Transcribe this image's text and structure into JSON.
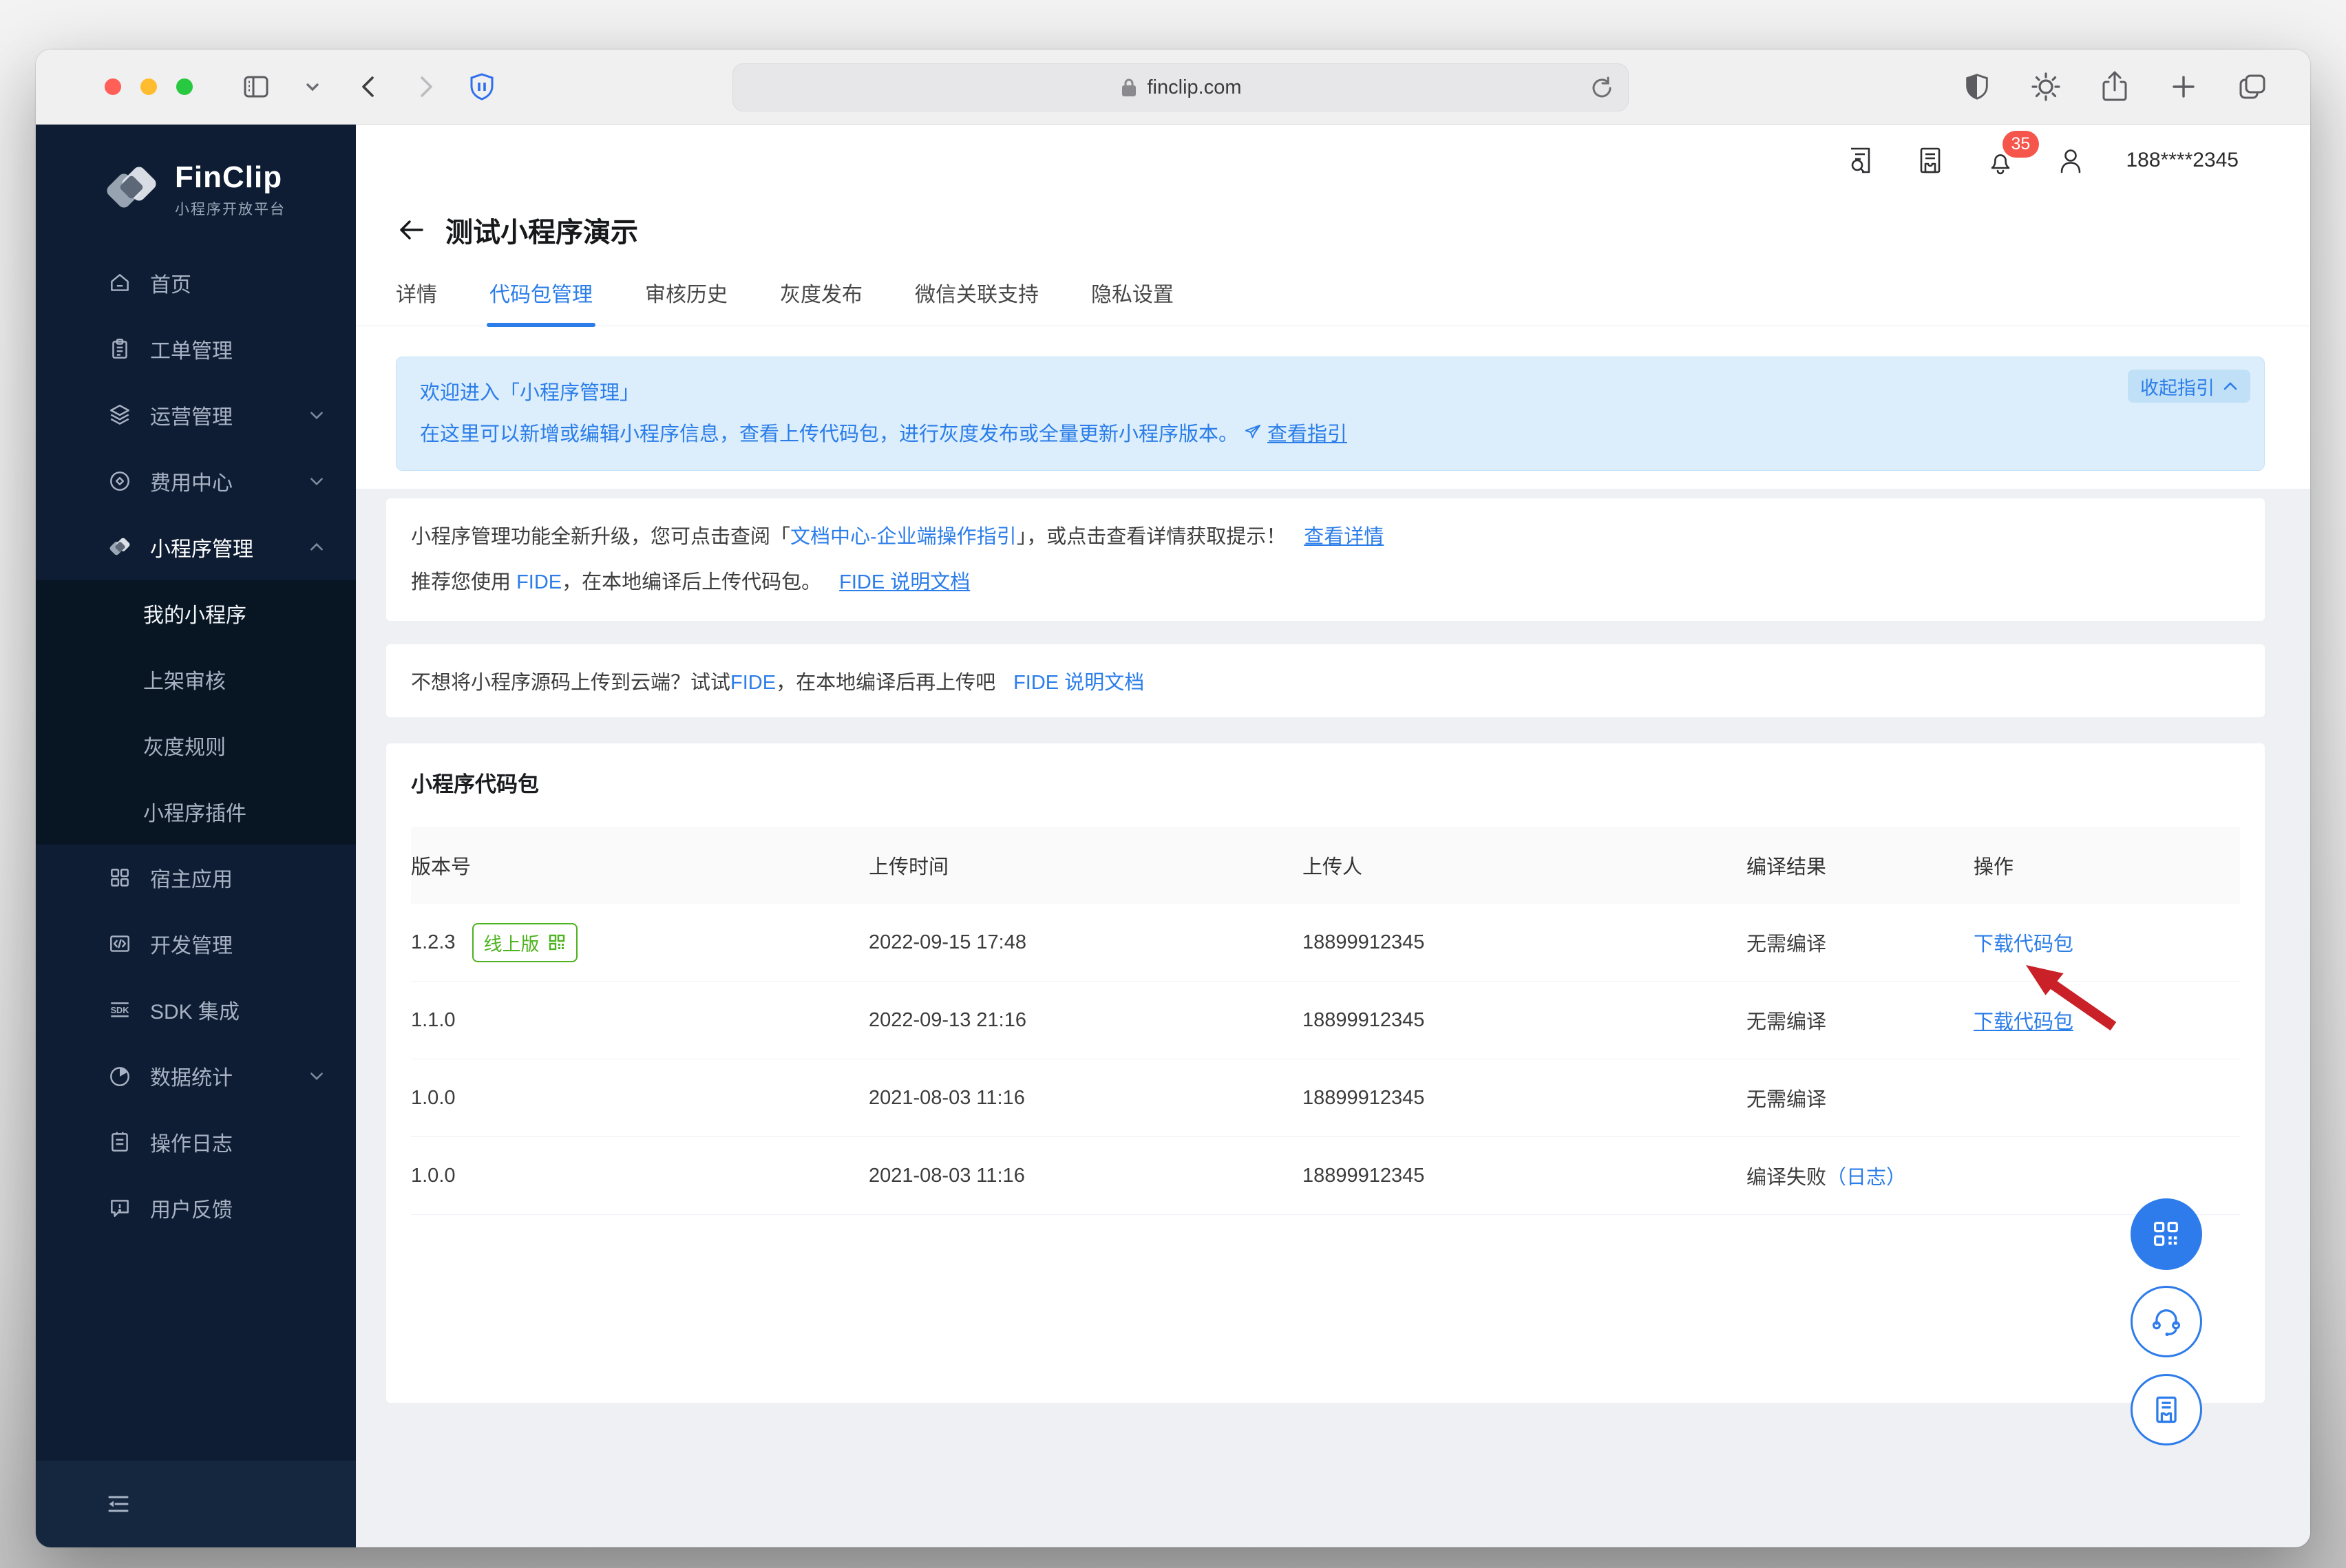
{
  "browser": {
    "url": "finclip.com"
  },
  "topbar": {
    "notification_count": "35",
    "user_phone": "188****2345"
  },
  "sidebar": {
    "logo_title": "FinClip",
    "logo_subtitle": "小程序开放平台",
    "items": [
      {
        "label": "首页"
      },
      {
        "label": "工单管理"
      },
      {
        "label": "运营管理"
      },
      {
        "label": "费用中心"
      },
      {
        "label": "小程序管理"
      },
      {
        "label": "宿主应用"
      },
      {
        "label": "开发管理"
      },
      {
        "label": "SDK 集成"
      },
      {
        "label": "数据统计"
      },
      {
        "label": "操作日志"
      },
      {
        "label": "用户反馈"
      }
    ],
    "submenu": [
      {
        "label": "我的小程序"
      },
      {
        "label": "上架审核"
      },
      {
        "label": "灰度规则"
      },
      {
        "label": "小程序插件"
      }
    ]
  },
  "page": {
    "title": "测试小程序演示",
    "tabs": [
      {
        "label": "详情"
      },
      {
        "label": "代码包管理"
      },
      {
        "label": "审核历史"
      },
      {
        "label": "灰度发布"
      },
      {
        "label": "微信关联支持"
      },
      {
        "label": "隐私设置"
      }
    ],
    "banner": {
      "title": "欢迎进入「小程序管理」",
      "body": "在这里可以新增或编辑小程序信息，查看上传代码包，进行灰度发布或全量更新小程序版本。",
      "guide_link": "查看指引",
      "collapse_label": "收起指引"
    },
    "notice_upgrade": {
      "pre": "小程序管理功能全新升级，您可点击查阅「",
      "doc_link": "文档中心-企业端操作指引",
      "post": "」，或点击查看详情获取提示！",
      "detail_link": "查看详情",
      "line2_pre": "推荐您使用 ",
      "fide": "FIDE",
      "line2_post": "，在本地编译后上传代码包。",
      "fide_doc_link": "FIDE 说明文档"
    },
    "notice_fide": {
      "pre": "不想将小程序源码上传到云端？试试",
      "fide": "FIDE",
      "post": "，在本地编译后再上传吧",
      "doc_link": "FIDE 说明文档"
    },
    "package_section": {
      "title": "小程序代码包",
      "columns": [
        "版本号",
        "上传时间",
        "上传人",
        "编译结果",
        "操作"
      ],
      "online_badge": "线上版",
      "rows": [
        {
          "version": "1.2.3",
          "time": "2022-09-15 17:48",
          "uploader": "18899912345",
          "result": "无需编译",
          "action": "下载代码包"
        },
        {
          "version": "1.1.0",
          "time": "2022-09-13 21:16",
          "uploader": "18899912345",
          "result": "无需编译",
          "action": "下载代码包"
        },
        {
          "version": "1.0.0",
          "time": "2021-08-03 11:16",
          "uploader": "18899912345",
          "result": "无需编译",
          "action": ""
        },
        {
          "version": "1.0.0",
          "time": "2021-08-03 11:16",
          "uploader": "18899912345",
          "result": "编译失败",
          "result_link": "（日志）",
          "action": ""
        }
      ]
    }
  },
  "colors": {
    "accent": "#2b7de9",
    "sidebar_bg": "#0e1d33",
    "badge_green": "#4db31e",
    "notification_red": "#f5554a",
    "arrow_red": "#c92127",
    "banner_bg": "#dceefb"
  }
}
